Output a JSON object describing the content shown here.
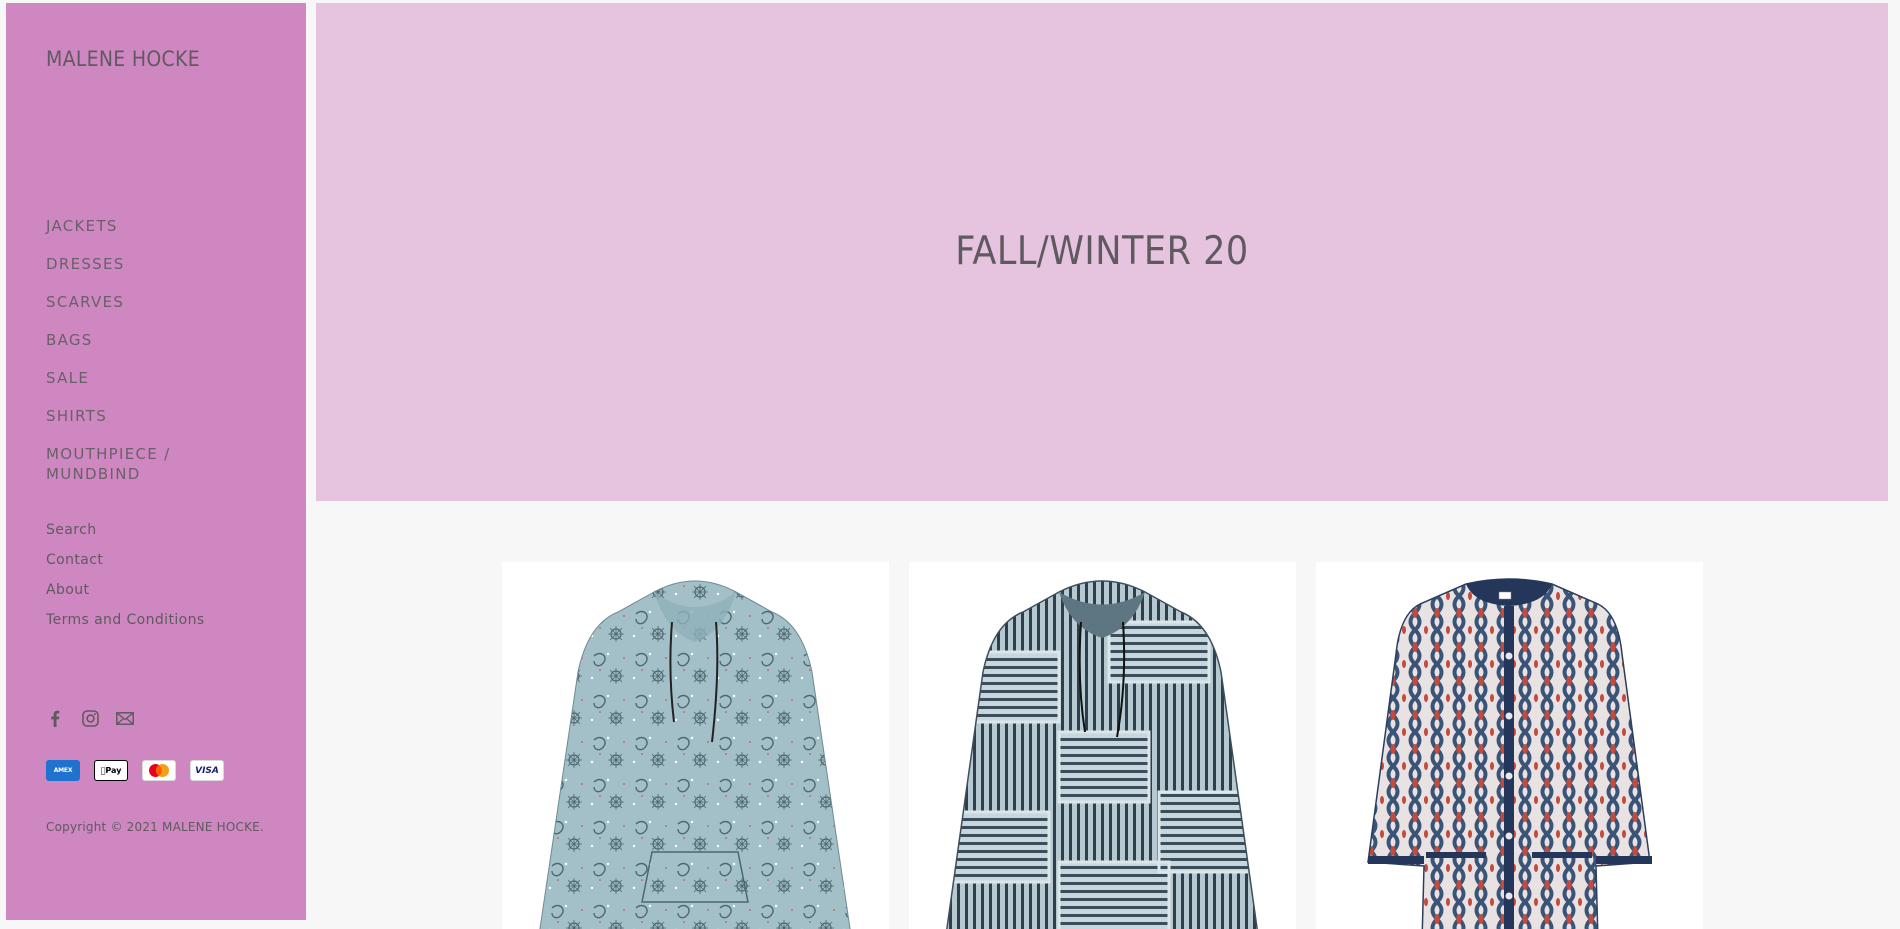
{
  "store": {
    "name": "MALENE HOCKE"
  },
  "sidebar": {
    "nav_items": [
      {
        "label": "JACKETS"
      },
      {
        "label": "DRESSES"
      },
      {
        "label": "SCARVES"
      },
      {
        "label": "BAGS"
      },
      {
        "label": "SALE"
      },
      {
        "label": "SHIRTS"
      },
      {
        "label": "MOUTHPIECE / MUNDBIND"
      }
    ],
    "secondary_links": [
      {
        "label": "Search"
      },
      {
        "label": "Contact"
      },
      {
        "label": "About"
      },
      {
        "label": "Terms and Conditions"
      }
    ],
    "social_icons": [
      "facebook-icon",
      "instagram-icon",
      "email-icon"
    ],
    "payment_methods": [
      {
        "name": "amex",
        "label": "AMEX"
      },
      {
        "name": "apple-pay",
        "label": "Pay"
      },
      {
        "name": "mastercard",
        "label": ""
      },
      {
        "name": "visa",
        "label": "VISA"
      }
    ],
    "copyright": "Copyright © 2021 MALENE HOCKE."
  },
  "hero": {
    "title": "FALL/WINTER 20"
  },
  "products": [
    {
      "name": "product-bandana-anorak",
      "pattern": "paisley",
      "color": "#a3c0c8"
    },
    {
      "name": "product-patchwork-anorak",
      "pattern": "stripes",
      "color": "#55707a"
    },
    {
      "name": "product-ikat-jacket",
      "pattern": "ikat",
      "color": "#3e5878"
    }
  ],
  "colors": {
    "sidebar_bg": "#cf87c2",
    "hero_bg": "#e6c4e0",
    "page_bg": "#f7f7f7",
    "text": "#5f5a5f"
  }
}
